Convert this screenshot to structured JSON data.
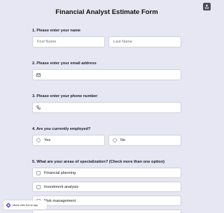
{
  "form": {
    "title": "Financial Analyst Estimate Form",
    "questions": {
      "name": {
        "label": "1.  Please enter your name",
        "first_placeholder": "First Name",
        "last_placeholder": "Last Name"
      },
      "email": {
        "label": "2.  Please enter your email address",
        "icon": "envelope-icon"
      },
      "phone": {
        "label": "3.  Please enter your phone number",
        "icon": "phone-icon"
      },
      "employed": {
        "label": "4.  Are you currently employed?",
        "options": [
          "Yes",
          "No"
        ]
      },
      "specialization": {
        "label": "5.  What are your areas of specialization? (Check more than one option)",
        "options": [
          "Financial planning",
          "Investment analysis",
          "Risk management"
        ]
      }
    }
  },
  "badge": {
    "text": "Made with forms.app",
    "icon": "forms-app-logo-icon"
  },
  "toolbar": {
    "share_icon": "share-icon"
  },
  "colors": {
    "background": "#e7e7f3",
    "field_background": "#ffffff",
    "field_border": "#cfd0db",
    "badge_logo": "#5b3fd6"
  }
}
